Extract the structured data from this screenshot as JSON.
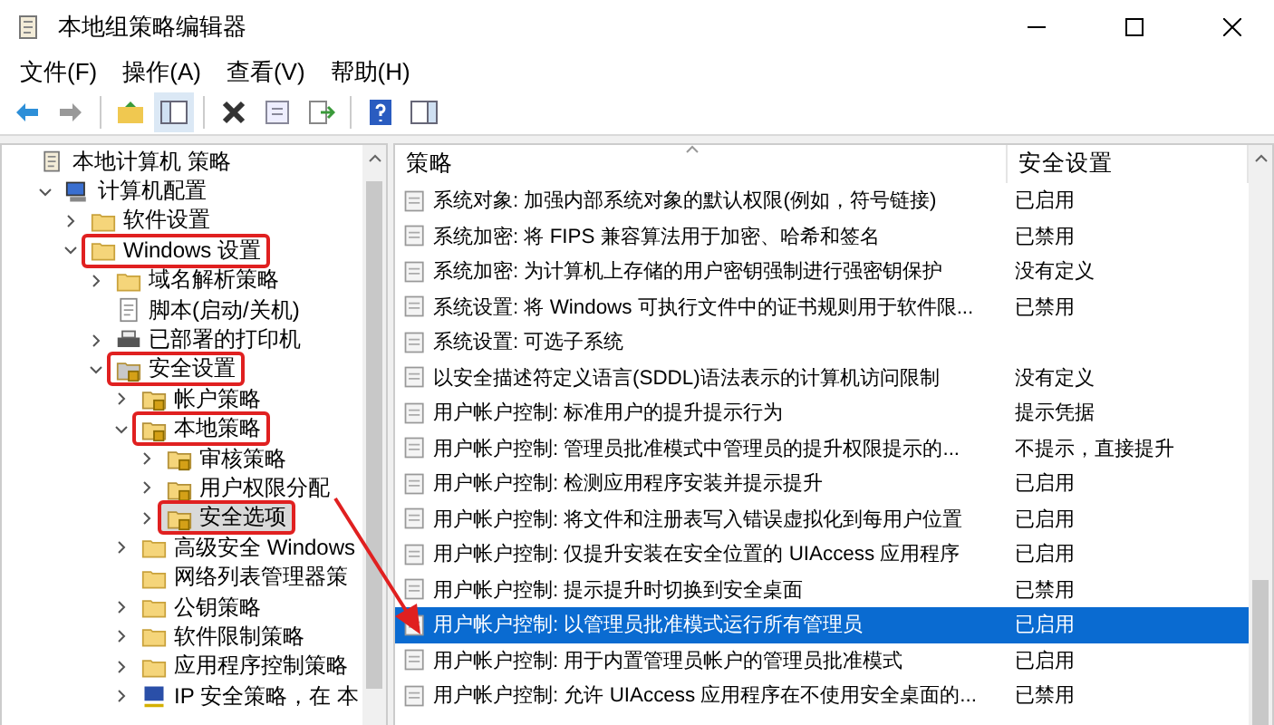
{
  "window": {
    "title": "本地组策略编辑器"
  },
  "menu": [
    "文件(F)",
    "操作(A)",
    "查看(V)",
    "帮助(H)"
  ],
  "tree": [
    {
      "label": "本地计算机 策略",
      "kind": "policy",
      "highlighted": false,
      "selected": false,
      "children": [
        {
          "label": "计算机配置",
          "kind": "computer",
          "expanded": true,
          "highlighted": false,
          "selected": false,
          "children": [
            {
              "label": "软件设置",
              "kind": "folder",
              "expanded": false,
              "highlighted": false,
              "selected": false
            },
            {
              "label": "Windows 设置",
              "kind": "folder",
              "expanded": true,
              "highlighted": true,
              "selected": false,
              "children": [
                {
                  "label": "域名解析策略",
                  "kind": "folder",
                  "expanded": false,
                  "highlighted": false,
                  "selected": false
                },
                {
                  "label": "脚本(启动/关机)",
                  "kind": "script",
                  "highlighted": false,
                  "selected": false
                },
                {
                  "label": "已部署的打印机",
                  "kind": "printer",
                  "expanded": false,
                  "highlighted": false,
                  "selected": false
                },
                {
                  "label": "安全设置",
                  "kind": "secure",
                  "expanded": true,
                  "highlighted": true,
                  "selected": false,
                  "children": [
                    {
                      "label": "帐户策略",
                      "kind": "lockfolder",
                      "expanded": false,
                      "highlighted": false,
                      "selected": false
                    },
                    {
                      "label": "本地策略",
                      "kind": "lockfolder",
                      "expanded": true,
                      "highlighted": true,
                      "selected": false,
                      "children": [
                        {
                          "label": "审核策略",
                          "kind": "lockfolder",
                          "expanded": false,
                          "highlighted": false,
                          "selected": false
                        },
                        {
                          "label": "用户权限分配",
                          "kind": "lockfolder",
                          "expanded": false,
                          "highlighted": false,
                          "selected": false
                        },
                        {
                          "label": "安全选项",
                          "kind": "lockfolder",
                          "expanded": false,
                          "highlighted": true,
                          "selected": true
                        }
                      ]
                    },
                    {
                      "label": "高级安全 Windows",
                      "kind": "folder",
                      "expanded": false,
                      "highlighted": false,
                      "selected": false
                    },
                    {
                      "label": "网络列表管理器策",
                      "kind": "folder",
                      "highlighted": false,
                      "selected": false
                    },
                    {
                      "label": "公钥策略",
                      "kind": "folder",
                      "expanded": false,
                      "highlighted": false,
                      "selected": false
                    },
                    {
                      "label": "软件限制策略",
                      "kind": "folder",
                      "expanded": false,
                      "highlighted": false,
                      "selected": false
                    },
                    {
                      "label": "应用程序控制策略",
                      "kind": "folder",
                      "expanded": false,
                      "highlighted": false,
                      "selected": false
                    },
                    {
                      "label": "IP 安全策略，在 本",
                      "kind": "ip",
                      "expanded": false,
                      "highlighted": false,
                      "selected": false
                    }
                  ]
                }
              ]
            }
          ]
        }
      ]
    }
  ],
  "table": {
    "columns": [
      "策略",
      "安全设置"
    ],
    "rows": [
      {
        "policy": "系统对象: 加强内部系统对象的默认权限(例如，符号链接)",
        "setting": "已启用",
        "selected": false
      },
      {
        "policy": "系统加密: 将 FIPS 兼容算法用于加密、哈希和签名",
        "setting": "已禁用",
        "selected": false
      },
      {
        "policy": "系统加密: 为计算机上存储的用户密钥强制进行强密钥保护",
        "setting": "没有定义",
        "selected": false
      },
      {
        "policy": "系统设置: 将 Windows 可执行文件中的证书规则用于软件限...",
        "setting": "已禁用",
        "selected": false
      },
      {
        "policy": "系统设置: 可选子系统",
        "selected": false
      },
      {
        "policy": "以安全描述符定义语言(SDDL)语法表示的计算机访问限制",
        "setting": "没有定义",
        "selected": false
      },
      {
        "policy": "用户帐户控制: 标准用户的提升提示行为",
        "setting": "提示凭据",
        "selected": false
      },
      {
        "policy": "用户帐户控制: 管理员批准模式中管理员的提升权限提示的...",
        "setting": "不提示，直接提升",
        "selected": false
      },
      {
        "policy": "用户帐户控制: 检测应用程序安装并提示提升",
        "setting": "已启用",
        "selected": false
      },
      {
        "policy": "用户帐户控制: 将文件和注册表写入错误虚拟化到每用户位置",
        "setting": "已启用",
        "selected": false
      },
      {
        "policy": "用户帐户控制: 仅提升安装在安全位置的 UIAccess 应用程序",
        "setting": "已启用",
        "selected": false
      },
      {
        "policy": "用户帐户控制: 提示提升时切换到安全桌面",
        "setting": "已禁用",
        "selected": false
      },
      {
        "policy": "用户帐户控制: 以管理员批准模式运行所有管理员",
        "setting": "已启用",
        "selected": true
      },
      {
        "policy": "用户帐户控制: 用于内置管理员帐户的管理员批准模式",
        "setting": "已启用",
        "selected": false
      },
      {
        "policy": "用户帐户控制: 允许 UIAccess 应用程序在不使用安全桌面的...",
        "setting": "已禁用",
        "selected": false
      }
    ]
  }
}
